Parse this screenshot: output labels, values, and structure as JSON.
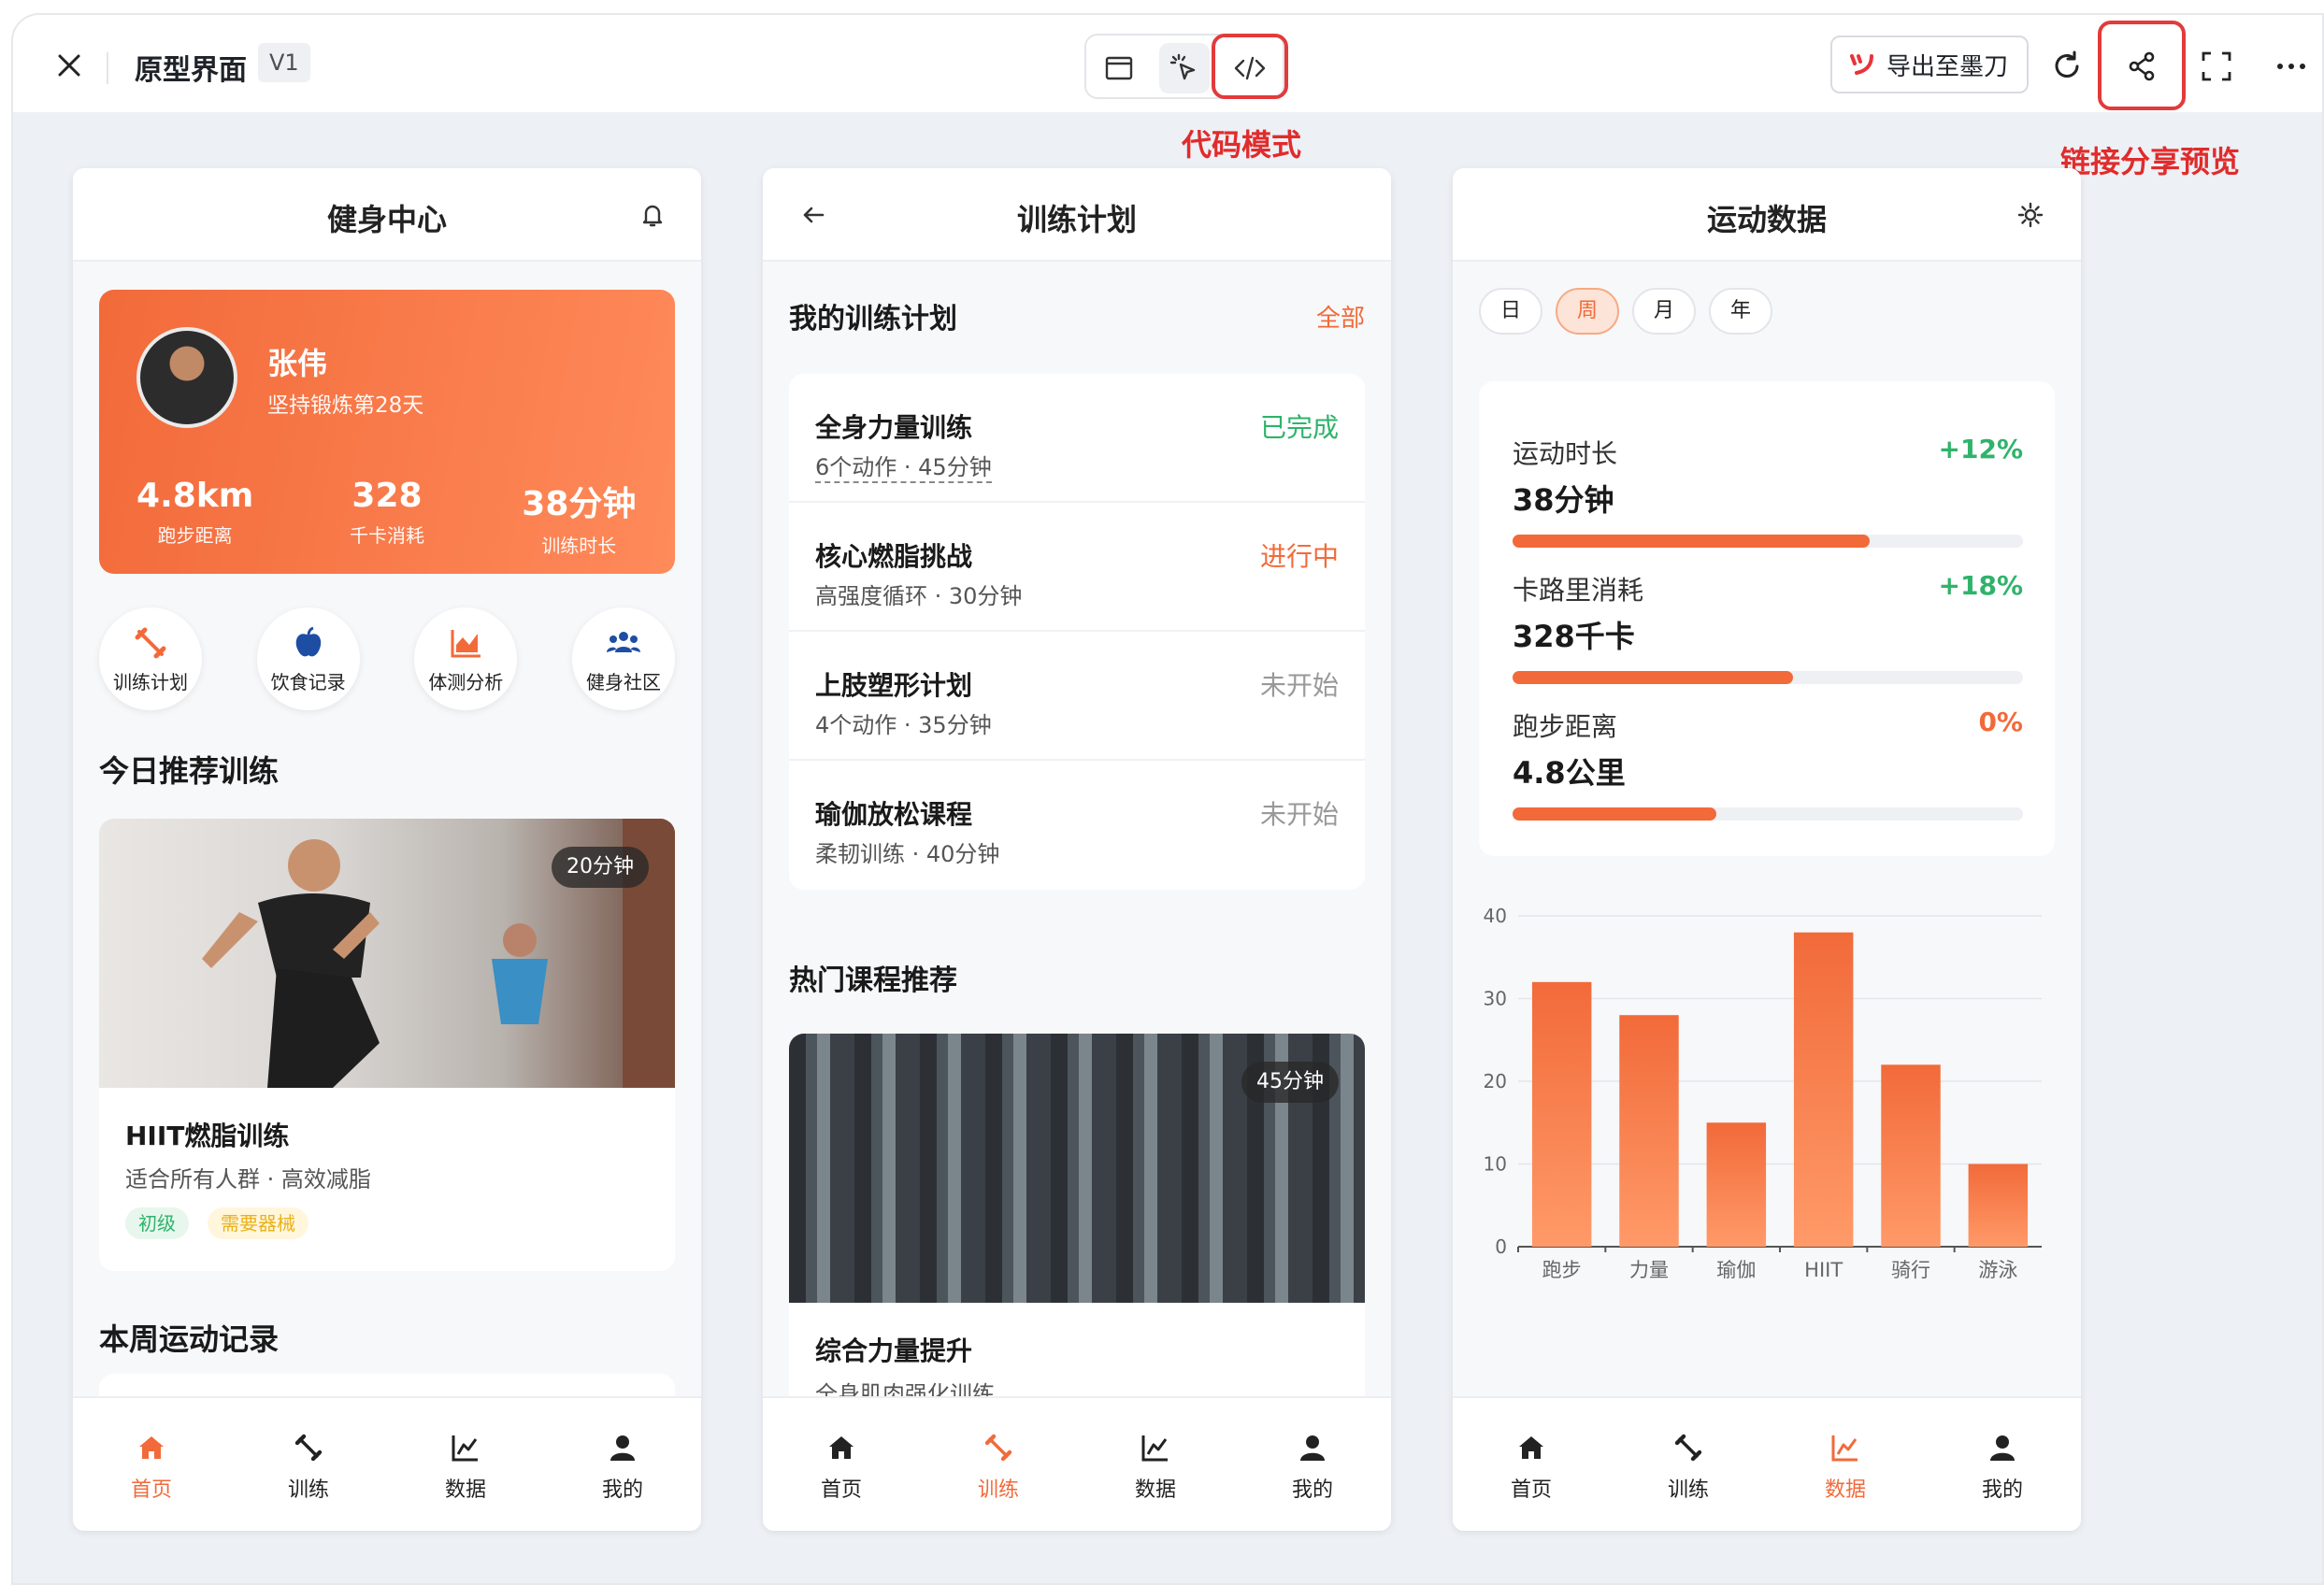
{
  "topbar": {
    "title": "原型界面",
    "version": "V1",
    "export_label": "导出至墨刀",
    "annot_code_mode": "代码模式",
    "annot_share": "链接分享预览"
  },
  "colors": {
    "accent": "#f26a3a",
    "success": "#2fb36b",
    "annotation": "#e02c2c"
  },
  "phone1": {
    "title": "健身中心",
    "user": {
      "name": "张伟",
      "subtitle": "坚持锻炼第28天"
    },
    "stats": [
      {
        "value": "4.8km",
        "label": "跑步距离"
      },
      {
        "value": "328",
        "label": "千卡消耗"
      },
      {
        "value": "38分钟",
        "label": "训练时长"
      }
    ],
    "quick": [
      {
        "label": "训练计划",
        "icon": "dumbbell-icon"
      },
      {
        "label": "饮食记录",
        "icon": "apple-icon"
      },
      {
        "label": "体测分析",
        "icon": "chart-area-icon"
      },
      {
        "label": "健身社区",
        "icon": "users-icon"
      }
    ],
    "section_today": "今日推荐训练",
    "recommend": {
      "duration": "20分钟",
      "name": "HIIT燃脂训练",
      "subtitle": "适合所有人群 · 高效减脂",
      "tags": [
        "初级",
        "需要器械"
      ]
    },
    "section_week": "本周运动记录"
  },
  "phone2": {
    "title": "训练计划",
    "section_plans": "我的训练计划",
    "all_link": "全部",
    "plans": [
      {
        "name": "全身力量训练",
        "sub": "6个动作 · 45分钟",
        "status": "已完成"
      },
      {
        "name": "核心燃脂挑战",
        "sub": "高强度循环 · 30分钟",
        "status": "进行中"
      },
      {
        "name": "上肢塑形计划",
        "sub": "4个动作 · 35分钟",
        "status": "未开始"
      },
      {
        "name": "瑜伽放松课程",
        "sub": "柔韧训练 · 40分钟",
        "status": "未开始"
      }
    ],
    "section_hot": "热门课程推荐",
    "course": {
      "duration": "45分钟",
      "name": "综合力量提升",
      "sub": "全身肌肉强化训练"
    }
  },
  "phone3": {
    "title": "运动数据",
    "periods": [
      "日",
      "周",
      "月",
      "年"
    ],
    "active_period": "周",
    "metrics": [
      {
        "label": "运动时长",
        "value": "38分钟",
        "change": "+12%",
        "progress": 0.7
      },
      {
        "label": "卡路里消耗",
        "value": "328千卡",
        "change": "+18%",
        "progress": 0.55
      },
      {
        "label": "跑步距离",
        "value": "4.8公里",
        "change": "0%",
        "progress": 0.4
      }
    ]
  },
  "tabs": [
    "首页",
    "训练",
    "数据",
    "我的"
  ],
  "chart_data": {
    "type": "bar",
    "categories": [
      "跑步",
      "力量",
      "瑜伽",
      "HIIT",
      "骑行",
      "游泳"
    ],
    "values": [
      32,
      28,
      15,
      38,
      22,
      10
    ],
    "ylim": [
      0,
      40
    ],
    "yticks": [
      0,
      10,
      20,
      30,
      40
    ],
    "grid": true,
    "color": "#f26a3a"
  }
}
